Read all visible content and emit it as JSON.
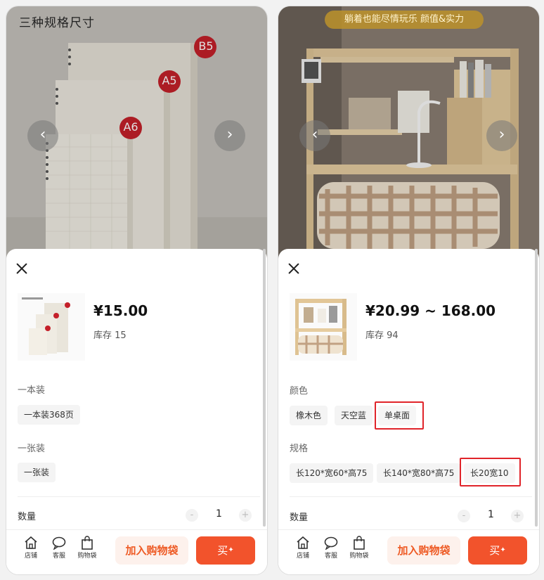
{
  "left": {
    "hero_title": "三种规格尺寸",
    "badges": [
      "B5",
      "A5",
      "A6"
    ],
    "price": "¥15.00",
    "stock": "库存 15",
    "sections": [
      {
        "title": "一本装",
        "options": [
          "一本装368页"
        ]
      },
      {
        "title": "一张装",
        "options": [
          "一张装"
        ]
      }
    ],
    "quantity_label": "数量",
    "quantity": "1"
  },
  "right": {
    "banner": "躺着也能尽情玩乐 颜值&实力",
    "price": "¥20.99 ~ 168.00",
    "stock": "库存 94",
    "sections": [
      {
        "title": "颜色",
        "options": [
          "橡木色",
          "天空蓝",
          "单桌面"
        ],
        "selected": "单桌面"
      },
      {
        "title": "规格",
        "options": [
          "长120*宽60*高75",
          "长140*宽80*高75",
          "长20宽10"
        ],
        "selected": "长20宽10"
      }
    ],
    "quantity_label": "数量",
    "quantity": "1"
  },
  "common": {
    "prev": "‹",
    "next": "›",
    "minus": "-",
    "plus": "+",
    "bar_icons": [
      "店铺",
      "客服",
      "购物袋"
    ],
    "add_to_cart": "加入购物袋",
    "buy": "买"
  },
  "colors": {
    "accent": "#f2532c",
    "selected_border": "#e0242a",
    "cart_text": "#ee5a24"
  }
}
